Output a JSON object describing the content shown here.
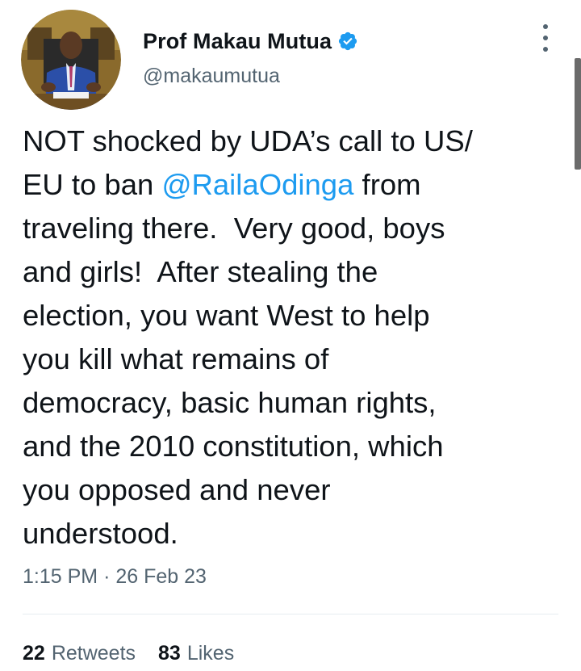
{
  "tweet": {
    "display_name": "Prof Makau Mutua",
    "handle": "@makaumutua",
    "verified": true,
    "text_segments": [
      {
        "text": "NOT shocked by UDA’s call to US/\nEU to ban ",
        "mention": false
      },
      {
        "text": "@RailaOdinga",
        "mention": true
      },
      {
        "text": " from\ntraveling there.  Very good, boys\nand girls!  After stealing the\nelection, you want West to help\nyou kill what remains of\ndemocracy, basic human rights,\nand the 2010 constitution, which\nyou opposed and never\nunderstood.",
        "mention": false
      }
    ],
    "time": "1:15 PM",
    "separator": "·",
    "date": "26 Feb 23",
    "retweets_count": "22",
    "retweets_label": "Retweets",
    "likes_count": "83",
    "likes_label": "Likes"
  },
  "icons": {
    "verified": "verified-badge-icon",
    "more": "more-vertical-icon"
  },
  "colors": {
    "accent": "#1d9bf0",
    "text_primary": "#0f1419",
    "text_secondary": "#536471",
    "divider": "#e6ecf0"
  }
}
